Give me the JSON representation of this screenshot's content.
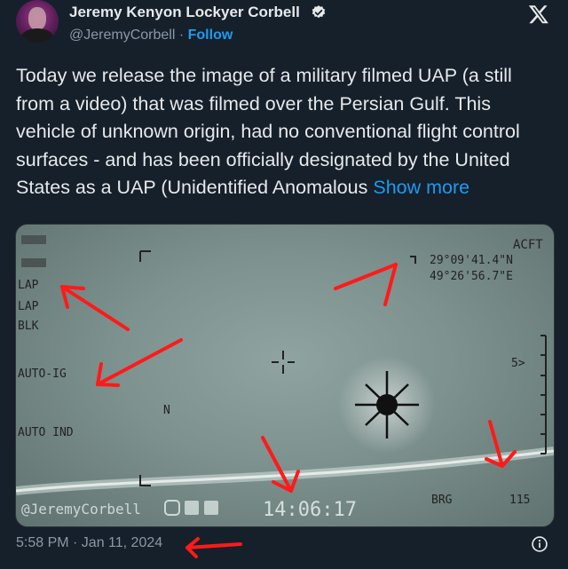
{
  "header": {
    "display_name": "Jeremy Kenyon Lockyer Corbell",
    "handle": "@JeremyCorbell",
    "separator": "·",
    "follow_label": "Follow",
    "icons": [
      "avatar",
      "verified-badge-icon",
      "x-logo-icon"
    ]
  },
  "tweet": {
    "text": "Today we release the image of a military filmed UAP (a still from a video) that was filmed over the Persian Gulf. This vehicle of unknown origin, had no conventional flight control surfaces - and has been officially designated by the United States as a UAP (Unidentified Anomalous",
    "show_more_label": "Show more"
  },
  "media": {
    "hud": {
      "acft_label": "ACFT",
      "lat": "29°09'41.4\"N",
      "lon": "49°26'56.7\"E",
      "lap1": "LAP",
      "lap2": "LAP",
      "blk": "BLK",
      "auto_ig": "AUTO-IG",
      "n_label": "N",
      "auto_ind": "AUTO IND",
      "watermark": "@JeremyCorbell",
      "time": "14:06:17",
      "brg_label": "BRG",
      "brg_value": "115",
      "right_mark": "5>"
    }
  },
  "footer": {
    "timestamp": "5:58 PM · Jan 11, 2024"
  },
  "colors": {
    "background": "#15202b",
    "text": "#e7e9ea",
    "muted": "#8b98a5",
    "accent": "#1d9bf0",
    "annotation": "#ff1a1a"
  }
}
